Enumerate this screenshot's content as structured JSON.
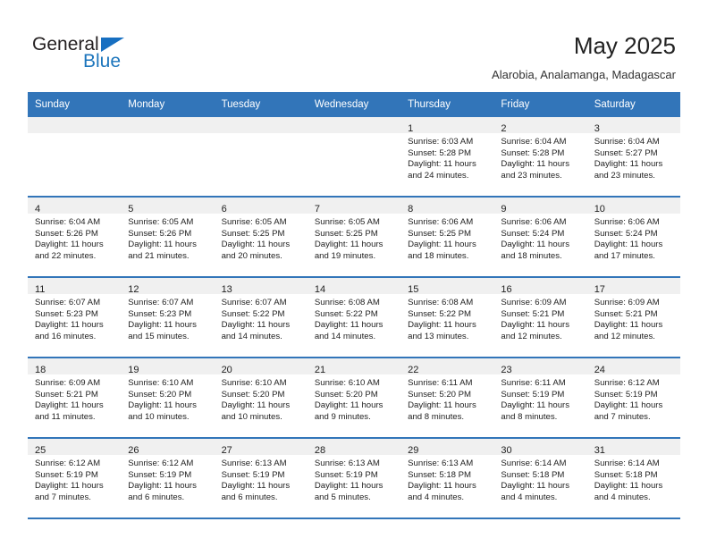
{
  "brand": {
    "name_part1": "General",
    "name_part2": "Blue",
    "triangle_color": "#176fc1",
    "blue_color": "#1c75bc"
  },
  "header": {
    "title": "May 2025",
    "subtitle": "Alarobia, Analamanga, Madagascar"
  },
  "theme": {
    "header_bg": "#3275b9",
    "header_text": "#ffffff",
    "daynum_band": "#f0f0f0",
    "cell_bg": "#ffffff",
    "row_divider": "#3275b9"
  },
  "weekday_headers": [
    "Sunday",
    "Monday",
    "Tuesday",
    "Wednesday",
    "Thursday",
    "Friday",
    "Saturday"
  ],
  "weeks": [
    [
      {
        "day": "",
        "empty": true,
        "sunrise": "",
        "sunset": "",
        "daylight_line1": "",
        "daylight_line2": ""
      },
      {
        "day": "",
        "empty": true,
        "sunrise": "",
        "sunset": "",
        "daylight_line1": "",
        "daylight_line2": ""
      },
      {
        "day": "",
        "empty": true,
        "sunrise": "",
        "sunset": "",
        "daylight_line1": "",
        "daylight_line2": ""
      },
      {
        "day": "",
        "empty": true,
        "sunrise": "",
        "sunset": "",
        "daylight_line1": "",
        "daylight_line2": ""
      },
      {
        "day": "1",
        "empty": false,
        "sunrise": "Sunrise: 6:03 AM",
        "sunset": "Sunset: 5:28 PM",
        "daylight_line1": "Daylight: 11 hours",
        "daylight_line2": "and 24 minutes."
      },
      {
        "day": "2",
        "empty": false,
        "sunrise": "Sunrise: 6:04 AM",
        "sunset": "Sunset: 5:28 PM",
        "daylight_line1": "Daylight: 11 hours",
        "daylight_line2": "and 23 minutes."
      },
      {
        "day": "3",
        "empty": false,
        "sunrise": "Sunrise: 6:04 AM",
        "sunset": "Sunset: 5:27 PM",
        "daylight_line1": "Daylight: 11 hours",
        "daylight_line2": "and 23 minutes."
      }
    ],
    [
      {
        "day": "4",
        "empty": false,
        "sunrise": "Sunrise: 6:04 AM",
        "sunset": "Sunset: 5:26 PM",
        "daylight_line1": "Daylight: 11 hours",
        "daylight_line2": "and 22 minutes."
      },
      {
        "day": "5",
        "empty": false,
        "sunrise": "Sunrise: 6:05 AM",
        "sunset": "Sunset: 5:26 PM",
        "daylight_line1": "Daylight: 11 hours",
        "daylight_line2": "and 21 minutes."
      },
      {
        "day": "6",
        "empty": false,
        "sunrise": "Sunrise: 6:05 AM",
        "sunset": "Sunset: 5:25 PM",
        "daylight_line1": "Daylight: 11 hours",
        "daylight_line2": "and 20 minutes."
      },
      {
        "day": "7",
        "empty": false,
        "sunrise": "Sunrise: 6:05 AM",
        "sunset": "Sunset: 5:25 PM",
        "daylight_line1": "Daylight: 11 hours",
        "daylight_line2": "and 19 minutes."
      },
      {
        "day": "8",
        "empty": false,
        "sunrise": "Sunrise: 6:06 AM",
        "sunset": "Sunset: 5:25 PM",
        "daylight_line1": "Daylight: 11 hours",
        "daylight_line2": "and 18 minutes."
      },
      {
        "day": "9",
        "empty": false,
        "sunrise": "Sunrise: 6:06 AM",
        "sunset": "Sunset: 5:24 PM",
        "daylight_line1": "Daylight: 11 hours",
        "daylight_line2": "and 18 minutes."
      },
      {
        "day": "10",
        "empty": false,
        "sunrise": "Sunrise: 6:06 AM",
        "sunset": "Sunset: 5:24 PM",
        "daylight_line1": "Daylight: 11 hours",
        "daylight_line2": "and 17 minutes."
      }
    ],
    [
      {
        "day": "11",
        "empty": false,
        "sunrise": "Sunrise: 6:07 AM",
        "sunset": "Sunset: 5:23 PM",
        "daylight_line1": "Daylight: 11 hours",
        "daylight_line2": "and 16 minutes."
      },
      {
        "day": "12",
        "empty": false,
        "sunrise": "Sunrise: 6:07 AM",
        "sunset": "Sunset: 5:23 PM",
        "daylight_line1": "Daylight: 11 hours",
        "daylight_line2": "and 15 minutes."
      },
      {
        "day": "13",
        "empty": false,
        "sunrise": "Sunrise: 6:07 AM",
        "sunset": "Sunset: 5:22 PM",
        "daylight_line1": "Daylight: 11 hours",
        "daylight_line2": "and 14 minutes."
      },
      {
        "day": "14",
        "empty": false,
        "sunrise": "Sunrise: 6:08 AM",
        "sunset": "Sunset: 5:22 PM",
        "daylight_line1": "Daylight: 11 hours",
        "daylight_line2": "and 14 minutes."
      },
      {
        "day": "15",
        "empty": false,
        "sunrise": "Sunrise: 6:08 AM",
        "sunset": "Sunset: 5:22 PM",
        "daylight_line1": "Daylight: 11 hours",
        "daylight_line2": "and 13 minutes."
      },
      {
        "day": "16",
        "empty": false,
        "sunrise": "Sunrise: 6:09 AM",
        "sunset": "Sunset: 5:21 PM",
        "daylight_line1": "Daylight: 11 hours",
        "daylight_line2": "and 12 minutes."
      },
      {
        "day": "17",
        "empty": false,
        "sunrise": "Sunrise: 6:09 AM",
        "sunset": "Sunset: 5:21 PM",
        "daylight_line1": "Daylight: 11 hours",
        "daylight_line2": "and 12 minutes."
      }
    ],
    [
      {
        "day": "18",
        "empty": false,
        "sunrise": "Sunrise: 6:09 AM",
        "sunset": "Sunset: 5:21 PM",
        "daylight_line1": "Daylight: 11 hours",
        "daylight_line2": "and 11 minutes."
      },
      {
        "day": "19",
        "empty": false,
        "sunrise": "Sunrise: 6:10 AM",
        "sunset": "Sunset: 5:20 PM",
        "daylight_line1": "Daylight: 11 hours",
        "daylight_line2": "and 10 minutes."
      },
      {
        "day": "20",
        "empty": false,
        "sunrise": "Sunrise: 6:10 AM",
        "sunset": "Sunset: 5:20 PM",
        "daylight_line1": "Daylight: 11 hours",
        "daylight_line2": "and 10 minutes."
      },
      {
        "day": "21",
        "empty": false,
        "sunrise": "Sunrise: 6:10 AM",
        "sunset": "Sunset: 5:20 PM",
        "daylight_line1": "Daylight: 11 hours",
        "daylight_line2": "and 9 minutes."
      },
      {
        "day": "22",
        "empty": false,
        "sunrise": "Sunrise: 6:11 AM",
        "sunset": "Sunset: 5:20 PM",
        "daylight_line1": "Daylight: 11 hours",
        "daylight_line2": "and 8 minutes."
      },
      {
        "day": "23",
        "empty": false,
        "sunrise": "Sunrise: 6:11 AM",
        "sunset": "Sunset: 5:19 PM",
        "daylight_line1": "Daylight: 11 hours",
        "daylight_line2": "and 8 minutes."
      },
      {
        "day": "24",
        "empty": false,
        "sunrise": "Sunrise: 6:12 AM",
        "sunset": "Sunset: 5:19 PM",
        "daylight_line1": "Daylight: 11 hours",
        "daylight_line2": "and 7 minutes."
      }
    ],
    [
      {
        "day": "25",
        "empty": false,
        "sunrise": "Sunrise: 6:12 AM",
        "sunset": "Sunset: 5:19 PM",
        "daylight_line1": "Daylight: 11 hours",
        "daylight_line2": "and 7 minutes."
      },
      {
        "day": "26",
        "empty": false,
        "sunrise": "Sunrise: 6:12 AM",
        "sunset": "Sunset: 5:19 PM",
        "daylight_line1": "Daylight: 11 hours",
        "daylight_line2": "and 6 minutes."
      },
      {
        "day": "27",
        "empty": false,
        "sunrise": "Sunrise: 6:13 AM",
        "sunset": "Sunset: 5:19 PM",
        "daylight_line1": "Daylight: 11 hours",
        "daylight_line2": "and 6 minutes."
      },
      {
        "day": "28",
        "empty": false,
        "sunrise": "Sunrise: 6:13 AM",
        "sunset": "Sunset: 5:19 PM",
        "daylight_line1": "Daylight: 11 hours",
        "daylight_line2": "and 5 minutes."
      },
      {
        "day": "29",
        "empty": false,
        "sunrise": "Sunrise: 6:13 AM",
        "sunset": "Sunset: 5:18 PM",
        "daylight_line1": "Daylight: 11 hours",
        "daylight_line2": "and 4 minutes."
      },
      {
        "day": "30",
        "empty": false,
        "sunrise": "Sunrise: 6:14 AM",
        "sunset": "Sunset: 5:18 PM",
        "daylight_line1": "Daylight: 11 hours",
        "daylight_line2": "and 4 minutes."
      },
      {
        "day": "31",
        "empty": false,
        "sunrise": "Sunrise: 6:14 AM",
        "sunset": "Sunset: 5:18 PM",
        "daylight_line1": "Daylight: 11 hours",
        "daylight_line2": "and 4 minutes."
      }
    ]
  ]
}
